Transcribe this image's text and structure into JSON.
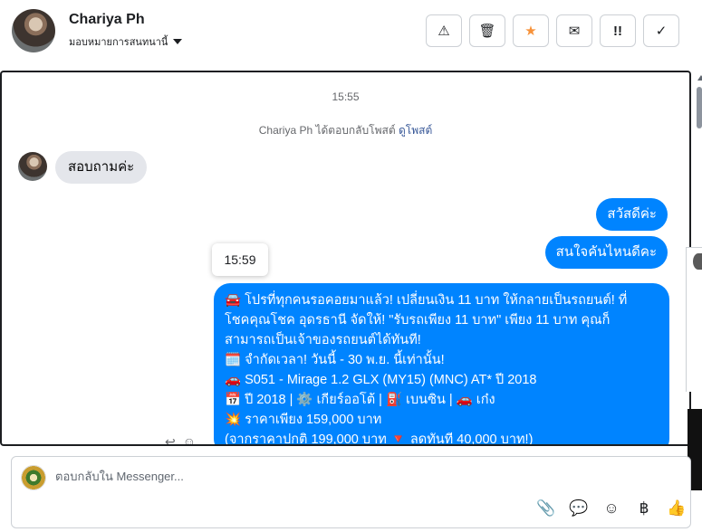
{
  "header": {
    "contact_name": "Chariya Ph",
    "assign_label": "มอบหมายการสนทนานี้",
    "toolbar": [
      {
        "name": "spam-button",
        "icon": "warning-icon",
        "glyph": "⚠"
      },
      {
        "name": "delete-button",
        "icon": "trash-icon",
        "glyph": "🗑"
      },
      {
        "name": "star-button",
        "icon": "star-icon",
        "glyph": "★"
      },
      {
        "name": "email-button",
        "icon": "envelope-icon",
        "glyph": "✉"
      },
      {
        "name": "mark-unread-button",
        "icon": "exclamation-icon",
        "glyph": "!!"
      },
      {
        "name": "done-button",
        "icon": "check-icon",
        "glyph": "✓"
      }
    ]
  },
  "conversation": {
    "timestamp_top": "15:55",
    "reply_note": {
      "text": "Chariya Ph ได้ตอบกลับโพสต์",
      "link": "ดูโพสต์"
    },
    "incoming_message": "สอบถามค่ะ",
    "outgoing_messages": [
      "สวัสดีค่ะ",
      "สนใจคันไหนดีคะ"
    ],
    "tooltip_time": "15:59",
    "promo_lines": [
      "🚘 โปรที่ทุกคนรอคอยมาแล้ว! เปลี่ยนเงิน 11 บาท ให้กลายเป็นรถยนต์! ที่",
      "โชคคุณโชค อุดรธานี จัดให้! \"รับรถเพียง 11 บาท\" เพียง 11 บาท คุณก็",
      "สามารถเป็นเจ้าของรถยนต์ได้ทันที!",
      "🗓️ จำกัดเวลา! วันนี้ - 30 พ.ย. นี้เท่านั้น!",
      "🚗 S051 - Mirage 1.2 GLX (MY15) (MNC) AT* ปี 2018",
      "📅 ปี 2018 | ⚙️ เกียร์ออโต้ | ⛽ เบนซิน | 🚗 เก๋ง",
      "💥 ราคาเพียง 159,000 บาท",
      "(จากราคาปกติ 199,000 บาท 🔻 ลดทันที 40,000 บาท!)"
    ],
    "message_actions": [
      {
        "name": "reply-icon",
        "glyph": "↩"
      },
      {
        "name": "react-emoji-icon",
        "glyph": "☺"
      }
    ]
  },
  "composer": {
    "placeholder": "ตอบกลับใน Messenger...",
    "tools": [
      {
        "name": "attach-icon",
        "glyph": "📎"
      },
      {
        "name": "saved-reply-icon",
        "glyph": "💬"
      },
      {
        "name": "emoji-icon",
        "glyph": "☺"
      },
      {
        "name": "baht-payment-icon",
        "glyph": "฿"
      },
      {
        "name": "thumbs-up-icon",
        "glyph": "👍"
      }
    ]
  },
  "colors": {
    "messenger_blue": "#0084ff",
    "incoming_bubble": "#e4e6eb",
    "star_orange": "#f7923a",
    "link_blue": "#385898"
  }
}
